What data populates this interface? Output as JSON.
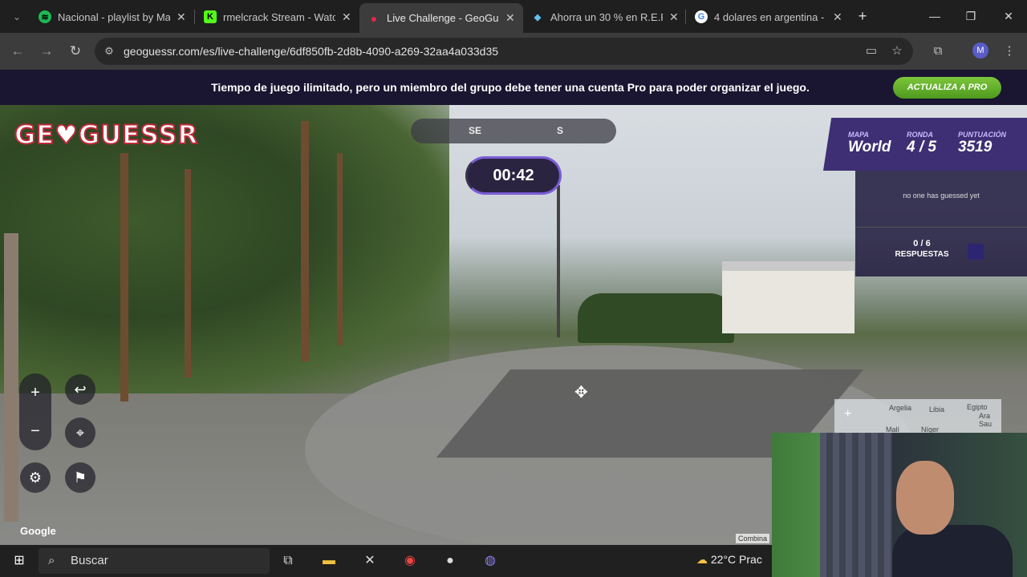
{
  "browser": {
    "tabs": [
      {
        "title": "Nacional - playlist by Ma",
        "icon": "spotify-icon"
      },
      {
        "title": "rmelcrack Stream - Watc",
        "icon": "kick-icon"
      },
      {
        "title": "Live Challenge - GeoGue",
        "icon": "geoguessr-icon"
      },
      {
        "title": "Ahorra un 30 % en R.E.P.",
        "icon": "steam-icon"
      },
      {
        "title": "4 dolares en argentina - ",
        "icon": "google-icon"
      }
    ],
    "url": "geoguessr.com/es/live-challenge/6df850fb-2d8b-4090-a269-32aa4a033d35",
    "profile_initial": "M"
  },
  "banner": {
    "text": "Tiempo de juego ilimitado, pero un miembro del grupo debe tener una cuenta Pro para poder organizar el juego.",
    "button": "ACTUALIZA A PRO"
  },
  "game": {
    "logo": "GE♥GUESSR",
    "compass": {
      "left": "SE",
      "right": "S"
    },
    "timer": "00:42",
    "map_label": "MAPA",
    "map_value": "World",
    "round_label": "RONDA",
    "round_value": "4 / 5",
    "score_label": "PUNTUACIÓN",
    "score_value": "3519",
    "guess_status": "no one has guessed yet",
    "answers_count": "0 / 6",
    "answers_label": "RESPUESTAS",
    "minimap_labels": [
      "Argelia",
      "Libia",
      "Egipto",
      "Ara Sau",
      "Malí",
      "Níger"
    ],
    "google_watermark": "Google",
    "combine_label": "Combina"
  },
  "taskbar": {
    "search_placeholder": "Buscar",
    "weather": "22°C  Prac"
  }
}
